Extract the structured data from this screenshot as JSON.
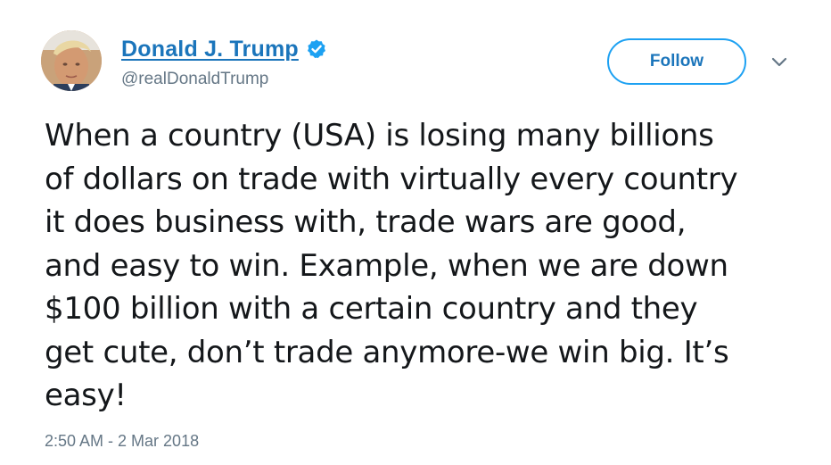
{
  "author": {
    "display_name": "Donald J. Trump",
    "handle": "@realDonaldTrump",
    "verified": true,
    "avatar_icon": "profile-photo",
    "verified_icon": "verified-badge-icon",
    "name_color": "#1b75bb"
  },
  "actions": {
    "follow_label": "Follow",
    "menu_icon": "chevron-down-icon",
    "accent_color": "#1da1f2"
  },
  "tweet": {
    "lines": [
      "When a country (USA) is losing many billions",
      "of dollars on trade with virtually every country",
      "it does business with, trade wars are good,",
      "and easy to win. Example, when we are down",
      "$100 billion with a certain country and they",
      "get cute, don’t trade anymore-we win big. It’s",
      "easy!"
    ],
    "timestamp": "2:50 AM - 2 Mar 2018"
  }
}
